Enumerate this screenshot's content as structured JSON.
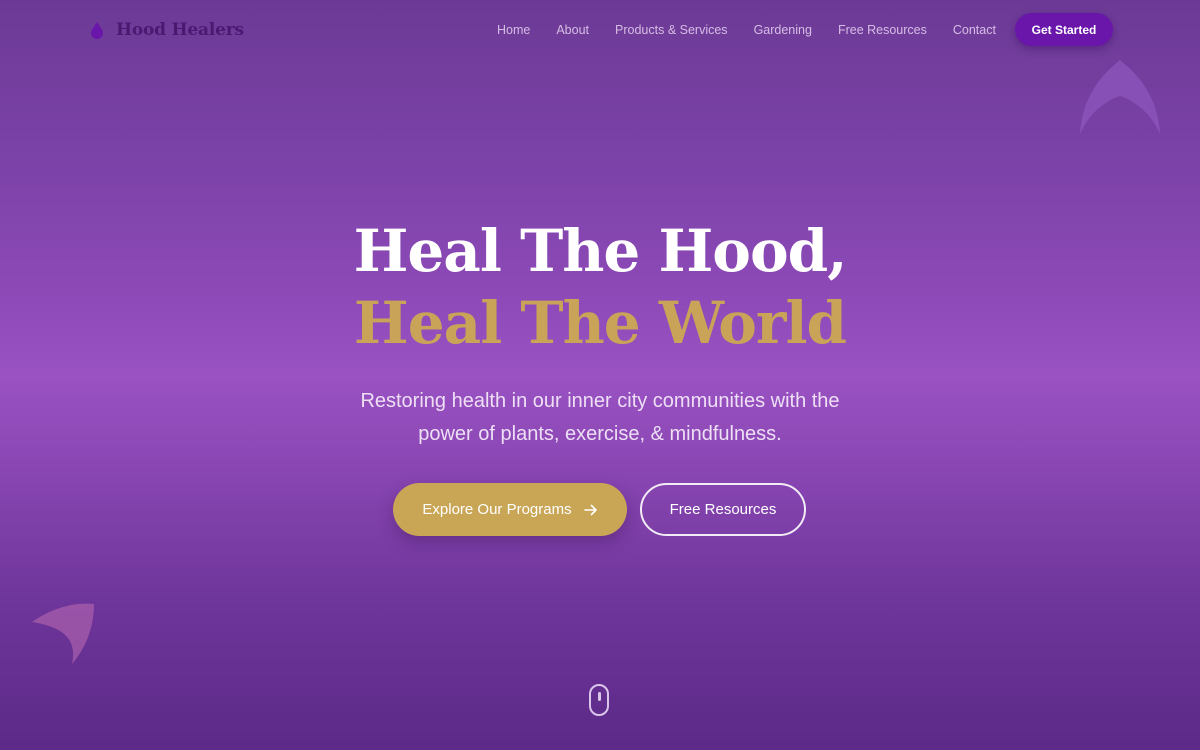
{
  "brand": {
    "name": "Hood Healers",
    "icon": "leaf-drop-icon",
    "color": "#4a1a70"
  },
  "nav": {
    "items": [
      {
        "label": "Home"
      },
      {
        "label": "About"
      },
      {
        "label": "Products & Services"
      },
      {
        "label": "Gardening"
      },
      {
        "label": "Free Resources"
      },
      {
        "label": "Contact"
      }
    ],
    "cta_label": "Get Started"
  },
  "hero": {
    "title_line1": "Heal The Hood,",
    "title_line2": "Heal The World",
    "subtitle_line1": "Restoring health in our inner city communities with the",
    "subtitle_line2": "power of plants, exercise, & mindfulness.",
    "primary_button": {
      "label": "Explore Our Programs",
      "icon": "arrow-right-icon"
    },
    "secondary_button": {
      "label": "Free Resources"
    }
  },
  "scroll_indicator": {
    "icon": "mouse-scroll-icon"
  },
  "colors": {
    "accent_gold": "#c9a458",
    "cta_purple": "#6a16aa",
    "background_purple": "#8e4ab8",
    "text_white": "#ffffff"
  }
}
